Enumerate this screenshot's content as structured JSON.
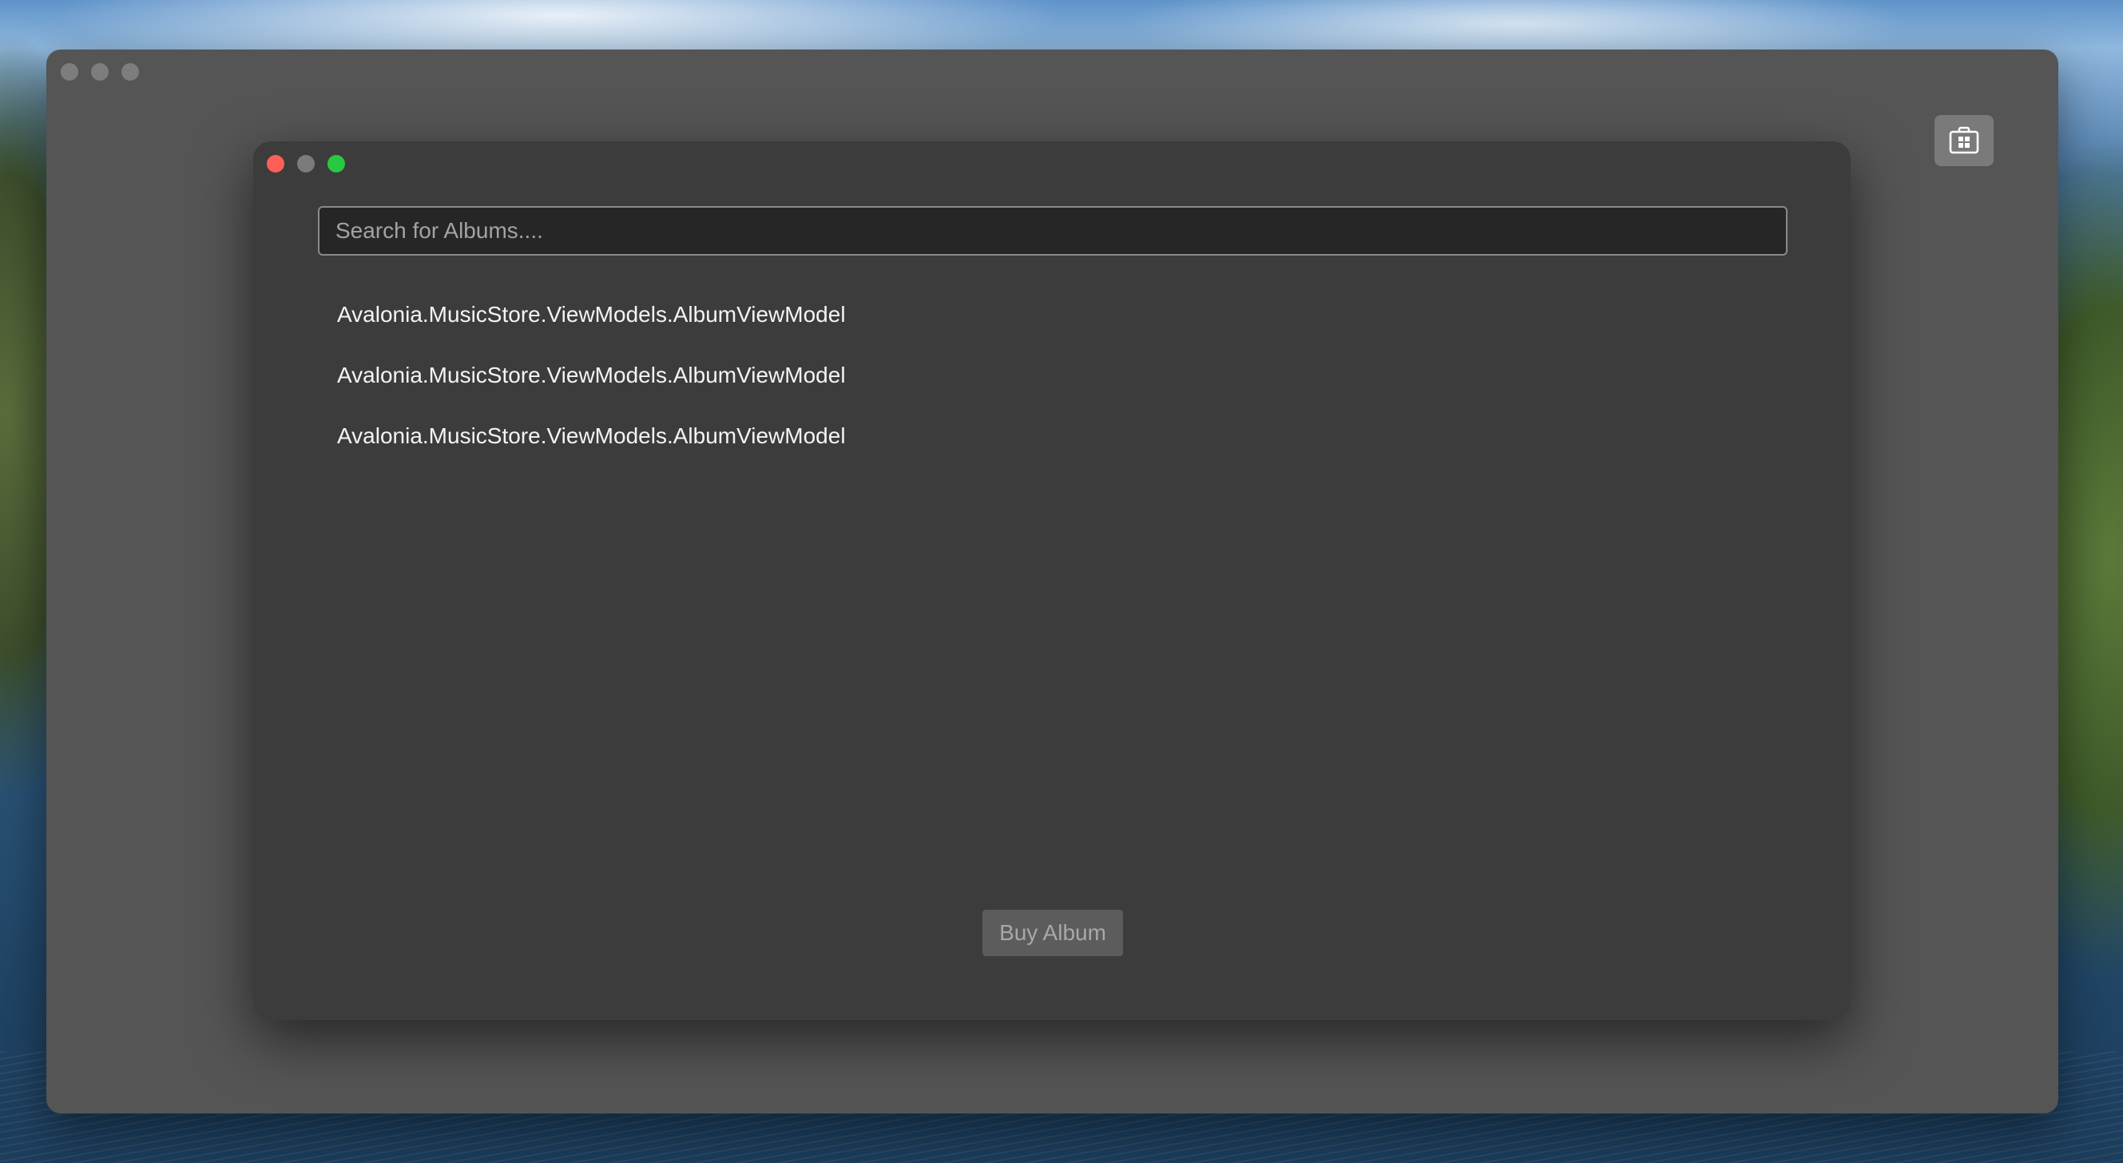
{
  "outer_window": {
    "store_button": {
      "icon": "store-icon"
    }
  },
  "dialog": {
    "search": {
      "value": "",
      "placeholder": "Search for Albums...."
    },
    "albums": [
      {
        "label": "Avalonia.MusicStore.ViewModels.AlbumViewModel"
      },
      {
        "label": "Avalonia.MusicStore.ViewModels.AlbumViewModel"
      },
      {
        "label": "Avalonia.MusicStore.ViewModels.AlbumViewModel"
      }
    ],
    "buy_button": {
      "label": "Buy Album",
      "enabled": false
    }
  },
  "colors": {
    "close": "#fe5f57",
    "zoom": "#28c840",
    "outer_bg": "#555555",
    "dialog_bg": "#3c3c3c"
  }
}
